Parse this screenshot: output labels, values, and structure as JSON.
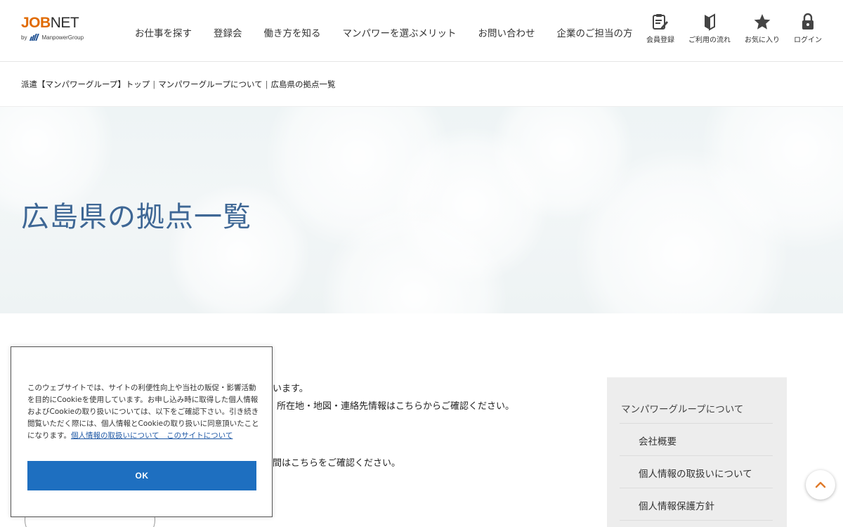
{
  "header": {
    "logo": {
      "brand_job": "JOB",
      "brand_net": "NET",
      "by": "by",
      "group": "ManpowerGroup"
    },
    "nav": [
      {
        "label": "お仕事を探す"
      },
      {
        "label": "登録会"
      },
      {
        "label": "働き方を知る"
      },
      {
        "label": "マンパワーを選ぶメリット"
      },
      {
        "label": "お問い合わせ"
      },
      {
        "label": "企業のご担当の方"
      }
    ],
    "utility": [
      {
        "label": "会員登録",
        "icon": "clipboard-pen-icon"
      },
      {
        "label": "ご利用の流れ",
        "icon": "beginner-mark-icon"
      },
      {
        "label": "お気に入り",
        "icon": "star-icon"
      },
      {
        "label": "ログイン",
        "icon": "lock-icon"
      }
    ]
  },
  "breadcrumb": {
    "items": [
      {
        "label": "派遣【マンパワーグループ】トップ"
      },
      {
        "label": "マンパワーグループについて"
      },
      {
        "label": "広島県の拠点一覧"
      }
    ],
    "separator": "|"
  },
  "hero": {
    "title": "広島県の拠点一覧"
  },
  "body": {
    "line1": "います。",
    "line2": "所在地・地図・連絡先情報はこちらからご確認ください。",
    "line3": "間はこちらをご確認ください。"
  },
  "sidebar": {
    "heading": "マンパワーグループについて",
    "items": [
      {
        "label": "会社概要"
      },
      {
        "label": "個人情報の取扱いについて"
      },
      {
        "label": "個人情報保護方針"
      }
    ]
  },
  "cookie": {
    "text": "このウェブサイトでは、サイトの利便性向上や当社の販促・影響活動を目的にCookieを使用しています。お申し込み時に取得した個人情報およびCookieの取り扱いについては、以下をご確認下さい。引き続き閲覧いただく際には、個人情報とCookieの取り扱いに同意頂いたことになります。",
    "link": "個人情報の取扱いについて　このサイトについて",
    "ok_label": "OK"
  },
  "colors": {
    "brand_orange": "#e06a00",
    "title_blue": "#3e6795",
    "button_blue": "#1e6fc0",
    "accent_orange": "#e07a2a"
  }
}
